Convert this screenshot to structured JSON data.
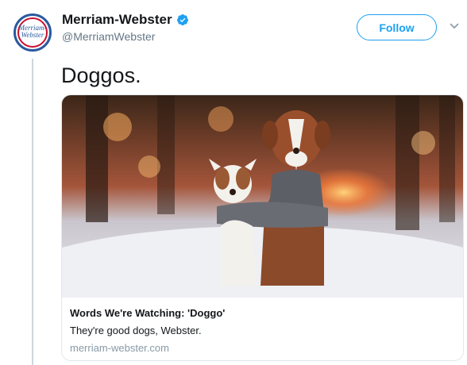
{
  "tweet": {
    "author": {
      "display_name": "Merriam-Webster",
      "handle": "@MerriamWebster",
      "avatar_text_line1": "Merriam-",
      "avatar_text_line2": "Webster",
      "verified": true
    },
    "follow_label": "Follow",
    "text": "Doggos.",
    "card": {
      "title": "Words We're Watching: 'Doggo'",
      "description": "They're good dogs, Webster.",
      "domain": "merriam-webster.com"
    }
  },
  "colors": {
    "accent": "#1da1f2",
    "text": "#14171a",
    "muted": "#657786",
    "brand_blue": "#2b5a9e",
    "brand_red": "#c8102e"
  },
  "icons": [
    "verified-badge-icon",
    "chevron-down-icon"
  ]
}
